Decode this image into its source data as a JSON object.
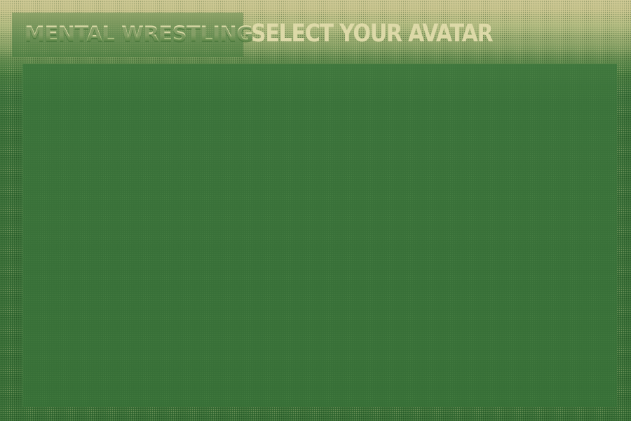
{
  "game": {
    "logo_text": "MENTAL WRESTLING",
    "screen_title": "SELECT YOUR AVATAR"
  },
  "colors": {
    "background_green": "#356b35",
    "header_khaki": "#cfc995",
    "title_text": "#ddd9a8"
  },
  "avatar_panel": {
    "avatars": []
  }
}
